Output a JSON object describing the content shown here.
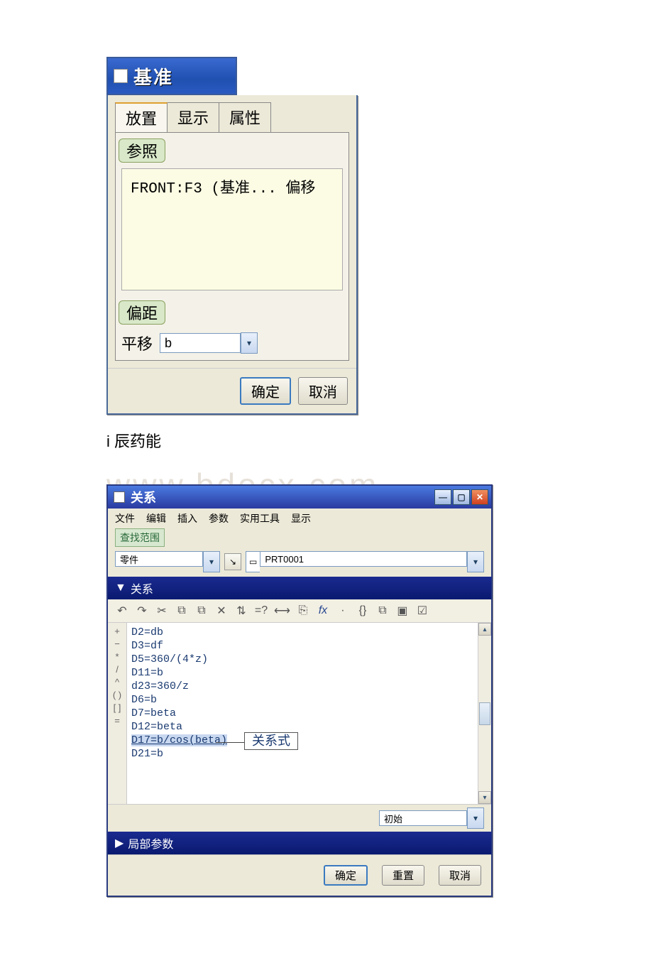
{
  "dlg1": {
    "title": "基准",
    "tabs": [
      "放置",
      "显示",
      "属性"
    ],
    "ref_label": "参照",
    "ref_entry": "FRONT:F3 (基准...   偏移",
    "offset_label": "偏距",
    "translate_label": "平移",
    "translate_value": "b",
    "ok": "确定",
    "cancel": "取消"
  },
  "caption": "i 辰药能",
  "watermark": "www.bdocx.com",
  "dlg2": {
    "title": "关系",
    "menu": [
      "文件",
      "编辑",
      "插入",
      "参数",
      "实用工具",
      "显示"
    ],
    "search_label": "查找范围",
    "scope_value": "零件",
    "part_value": "PRT0001",
    "section1": "关系",
    "toolbar": [
      "↶",
      "↷",
      "✂",
      "⧉",
      "⧉",
      "✕",
      "⇅",
      "=?",
      "⟷",
      "⎘",
      "fx",
      "·",
      "{}",
      "⧉",
      "▣",
      "☑"
    ],
    "gutter": [
      "+",
      "−",
      "*",
      "/",
      "^",
      "( )",
      "[ ]",
      "="
    ],
    "code_lines": [
      "D2=db",
      "D3=df",
      "D5=360/(4*z)",
      "D11=b",
      "d23=360/z",
      "D6=b",
      "D7=beta",
      "D12=beta",
      "D17=b/cos(beta)",
      "D21=b"
    ],
    "callout": "关系式",
    "footer_value": "初始",
    "section2": "局部参数",
    "ok": "确定",
    "reset": "重置",
    "cancel": "取消"
  }
}
